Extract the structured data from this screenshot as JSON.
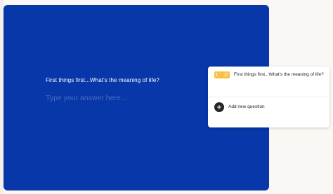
{
  "form": {
    "question": "First things first...What's the meaning of life?",
    "answer_placeholder": "Type your answer here...",
    "answer_value": ""
  },
  "colors": {
    "form_background": "#0737a8",
    "page_background": "#fbf7f4",
    "badge": "#f6c344",
    "dark": "#262627"
  },
  "side_panel": {
    "questions": [
      {
        "number": "1",
        "icon": "short-text-icon",
        "label": "First things first...What's the meaning of life?"
      }
    ],
    "add_label": "Add new question",
    "add_icon": "plus-icon"
  }
}
